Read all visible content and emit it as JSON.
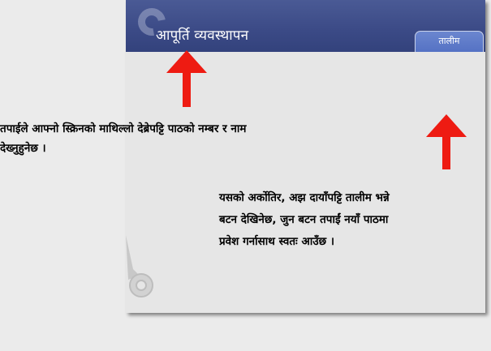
{
  "header": {
    "lesson_title": "आपूर्ति व्यवस्थापन",
    "training_button": "तालीम"
  },
  "notes": {
    "left_line1": "तपाईले आफ्नो स्क्रिनको माथिल्लो देब्रेपट्टि पाठको नम्बर र नाम",
    "left_line2": "देख्नुहुनेछ ।",
    "right_line1": "यसको अर्कोतिर, अझ दायाँपट्टि तालीम भन्ने",
    "right_line2": "बटन देखिनेछ, जुन बटन तपाईं नयाँ पाठमा",
    "right_line3": "प्रवेश गर्नासाथ स्वतः आउँछ ।"
  },
  "colors": {
    "header": "#3b4a86",
    "tab": "#5a76c8",
    "arrow": "#ee1b12",
    "panel": "#e6e6e6"
  },
  "icons": [
    "logo-ring-icon",
    "gear-decoration-icon",
    "up-arrow-icon"
  ]
}
